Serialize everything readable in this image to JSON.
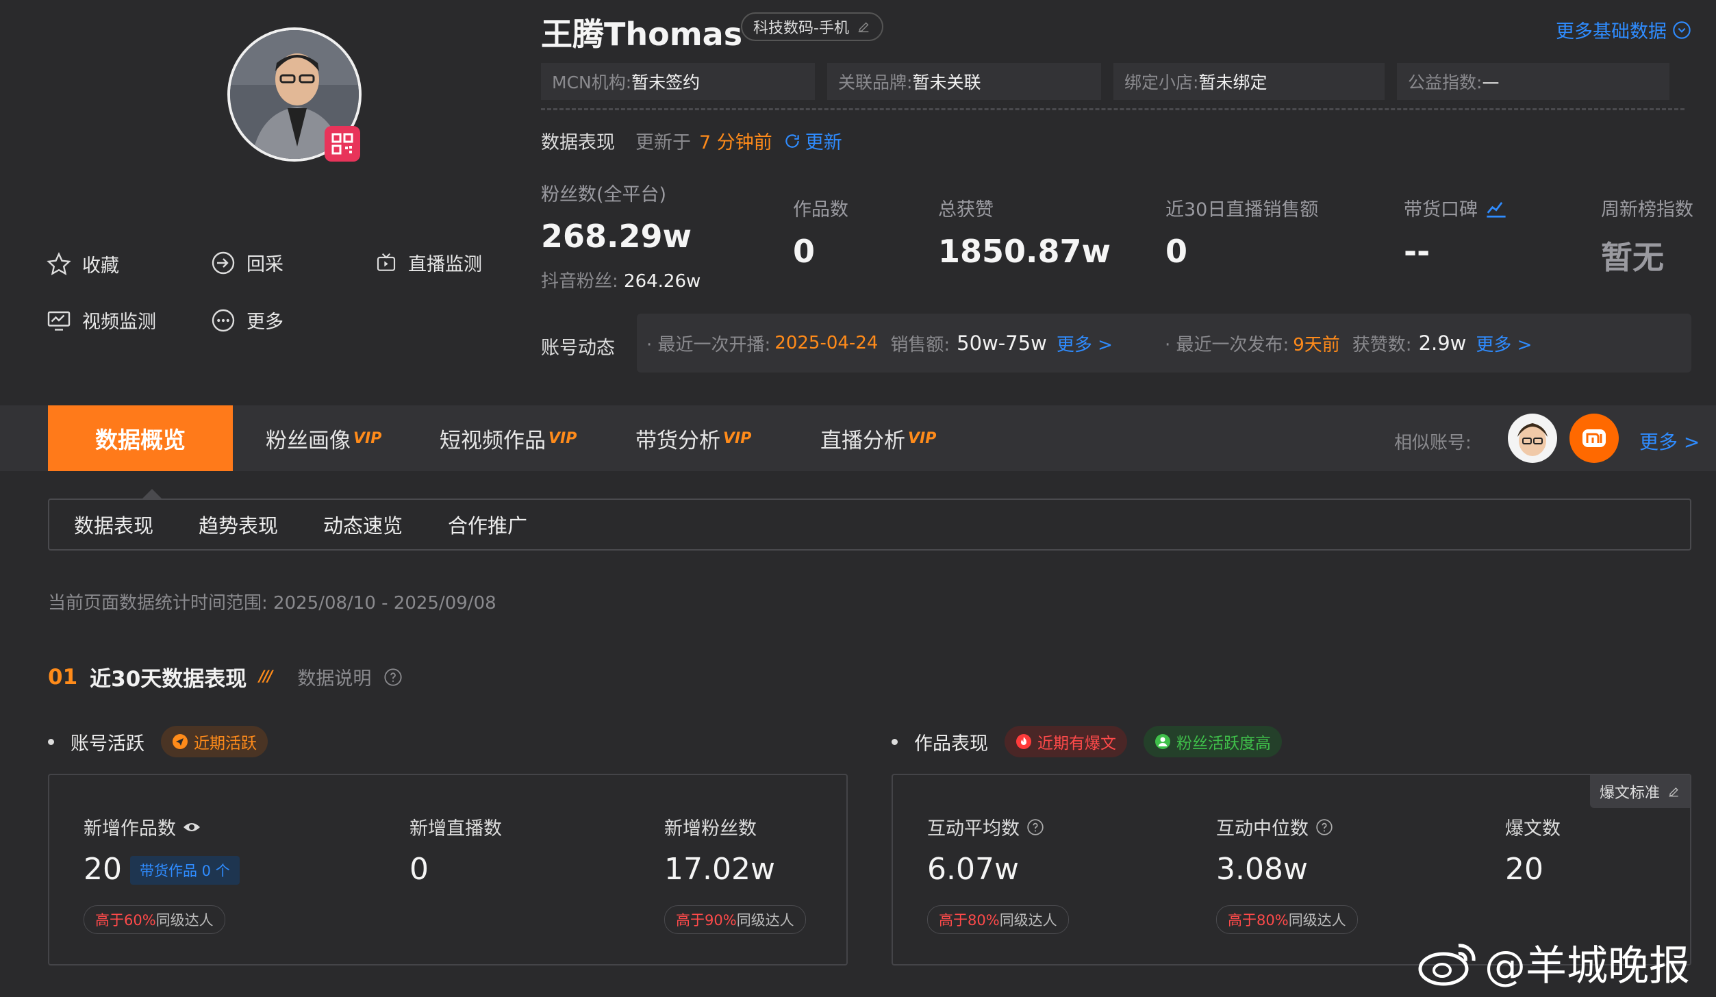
{
  "profile": {
    "name": "王腾Thomas",
    "category": "科技数码-手机",
    "more_basic_data": "更多基础数据",
    "fields": [
      {
        "key": "MCN机构:",
        "value": "暂未签约"
      },
      {
        "key": "关联品牌:",
        "value": "暂未关联"
      },
      {
        "key": "绑定小店:",
        "value": "暂未绑定"
      },
      {
        "key": "公益指数:",
        "value": "—"
      }
    ]
  },
  "actions": {
    "favorite": "收藏",
    "recollect": "回采",
    "live_monitor": "直播监测",
    "video_monitor": "视频监测",
    "more": "更多"
  },
  "data_perf": {
    "label": "数据表现",
    "updated_prefix": "更新于",
    "updated_time": "7 分钟前",
    "refresh": "更新"
  },
  "stats": {
    "fans_label": "粉丝数(全平台)",
    "fans_value": "268.29w",
    "douyin_fans_label": "抖音粉丝:",
    "douyin_fans_value": "264.26w",
    "works_label": "作品数",
    "works_value": "0",
    "likes_label": "总获赞",
    "likes_value": "1850.87w",
    "live_sales_label": "近30日直播销售额",
    "live_sales_value": "0",
    "goods_rep_label": "带货口碑",
    "goods_rep_value": "--",
    "weekly_rank_label": "周新榜指数",
    "weekly_rank_value": "暂无"
  },
  "account_dynamics": {
    "label": "账号动态",
    "last_live_label": "· 最近一次开播:",
    "last_live_date": "2025-04-24",
    "sales_label": "销售额:",
    "sales_value": "50w-75w",
    "more1": "更多 >",
    "last_post_label": "· 最近一次发布:",
    "last_post_value": "9天前",
    "likes_label": "获赞数:",
    "likes_value": "2.9w",
    "more2": "更多 >"
  },
  "tabs": {
    "active": "数据概览",
    "items": [
      "粉丝画像",
      "短视频作品",
      "带货分析",
      "直播分析"
    ],
    "vip": "VIP",
    "similar_label": "相似账号:",
    "similar_more": "更多 >"
  },
  "subtabs": [
    "数据表现",
    "趋势表现",
    "动态速览",
    "合作推广"
  ],
  "date_range": "当前页面数据统计时间范围: 2025/08/10 - 2025/09/08",
  "section": {
    "num": "01",
    "title": "近30天数据表现",
    "explain": "数据说明"
  },
  "account_activity": {
    "label": "账号活跃",
    "badge": "近期活跃",
    "metrics": [
      {
        "label": "新增作品数",
        "value": "20",
        "sub_badge": "带货作品 0 个",
        "compare_hi": "高于60%",
        "compare_rest": "同级达人"
      },
      {
        "label": "新增直播数",
        "value": "0"
      },
      {
        "label": "新增粉丝数",
        "value": "17.02w",
        "compare_hi": "高于90%",
        "compare_rest": "同级达人"
      }
    ]
  },
  "works_perf": {
    "label": "作品表现",
    "badge1": "近期有爆文",
    "badge2": "粉丝活跃度高",
    "standard": "爆文标准",
    "metrics": [
      {
        "label": "互动平均数",
        "value": "6.07w",
        "compare_hi": "高于80%",
        "compare_rest": "同级达人"
      },
      {
        "label": "互动中位数",
        "value": "3.08w",
        "compare_hi": "高于80%",
        "compare_rest": "同级达人"
      },
      {
        "label": "爆文数",
        "value": "20"
      }
    ]
  },
  "watermark": "@羊城晚报",
  "colors": {
    "accent": "#ff7a1a",
    "link": "#2f8cff",
    "danger": "#ff4a4a",
    "success": "#3fbf4a"
  }
}
